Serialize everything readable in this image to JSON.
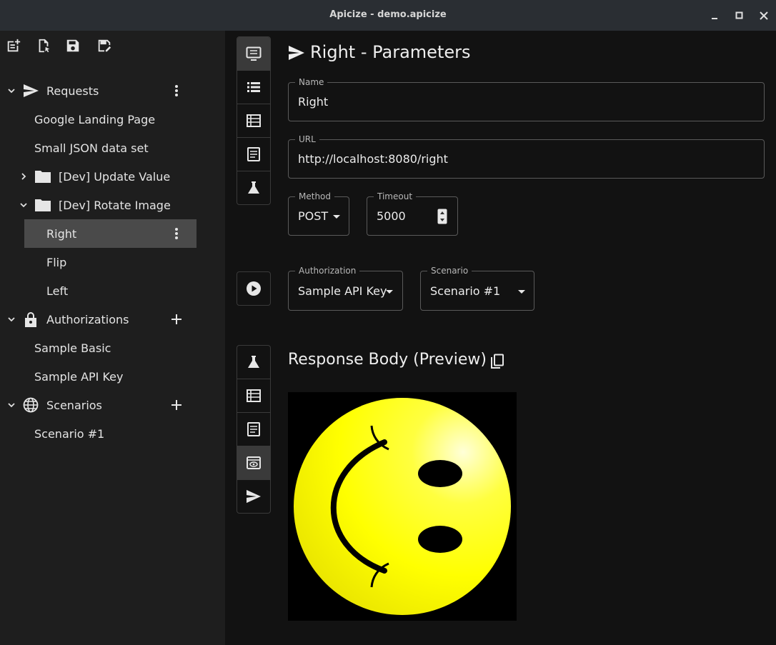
{
  "window": {
    "title": "Apicize - demo.apicize"
  },
  "sidebar": {
    "sections": {
      "requests": {
        "label": "Requests"
      },
      "authorizations": {
        "label": "Authorizations"
      },
      "scenarios": {
        "label": "Scenarios"
      }
    },
    "request_items": [
      {
        "label": "Google Landing Page"
      },
      {
        "label": "Small JSON data set"
      },
      {
        "label": "[Dev] Update Value"
      },
      {
        "label": "[Dev] Rotate Image"
      },
      {
        "label": "Right"
      },
      {
        "label": "Flip"
      },
      {
        "label": "Left"
      }
    ],
    "authorization_items": [
      {
        "label": "Sample Basic"
      },
      {
        "label": "Sample API Key"
      }
    ],
    "scenario_items": [
      {
        "label": "Scenario #1"
      }
    ]
  },
  "editor": {
    "title": "Right - Parameters",
    "name": {
      "label": "Name",
      "value": "Right"
    },
    "url": {
      "label": "URL",
      "value": "http://localhost:8080/right"
    },
    "method": {
      "label": "Method",
      "value": "POST"
    },
    "timeout": {
      "label": "Timeout",
      "value": "5000"
    },
    "authorization": {
      "label": "Authorization",
      "value": "Sample API Key"
    },
    "scenario": {
      "label": "Scenario",
      "value": "Scenario #1"
    }
  },
  "response": {
    "title": "Response Body (Preview)",
    "image": {
      "description": "smiley-face-rotated",
      "face_color": "#ffff00",
      "background": "#000000"
    }
  },
  "colors": {
    "accent_face": "#ffff00",
    "sidebar_bg": "#1e1e1e",
    "main_bg": "#121212",
    "selected_bg": "#4a4a4a"
  }
}
